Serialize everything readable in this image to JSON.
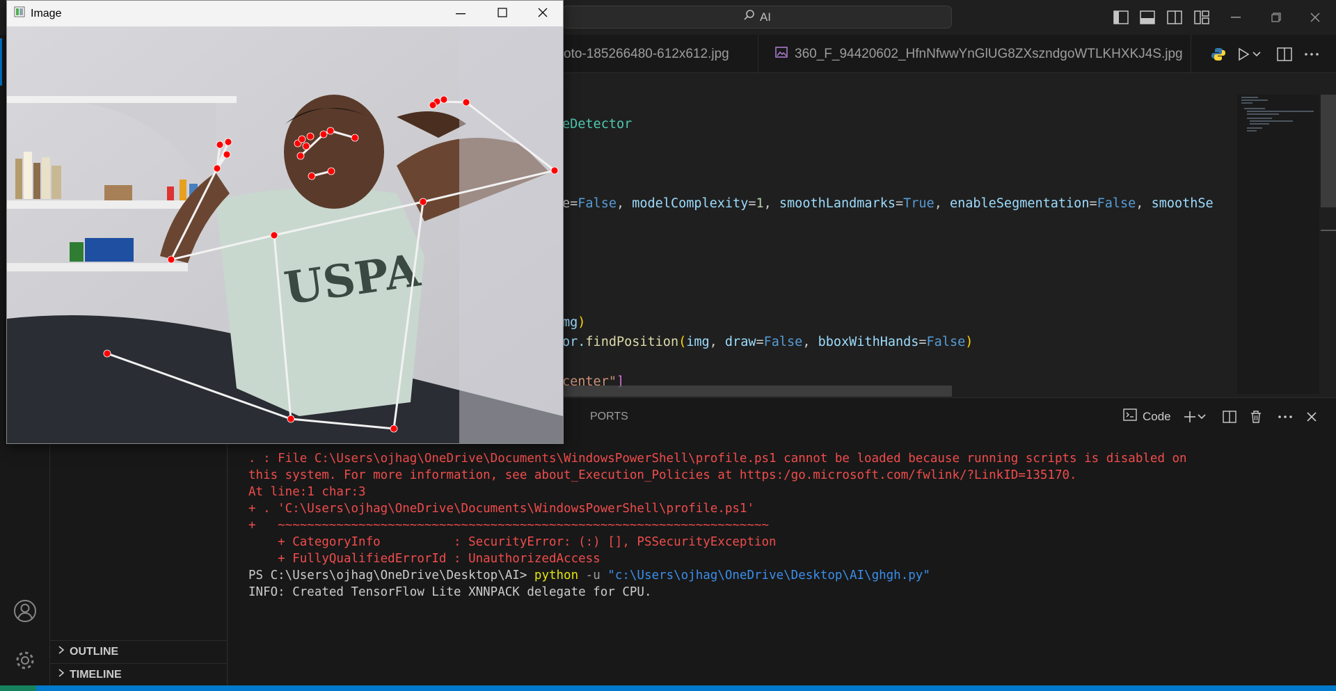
{
  "titlebar": {
    "search_text": "AI"
  },
  "tabs": [
    {
      "label": "oto-185266480-612x612.jpg"
    },
    {
      "label": "360_F_94420602_HfnNfwwYnGlUG8ZXszndgoWTLKHXKJ4S.jpg"
    }
  ],
  "editor": {
    "line1_suffix": "eDetector",
    "line2": {
      "p0": "e=",
      "v0": "False",
      "p1": ", ",
      "a1": "modelComplexity",
      "p2": "=",
      "v1": "1",
      "p3": ", ",
      "a2": "smoothLandmarks",
      "p4": "=",
      "v2": "True",
      "p5": ", ",
      "a3": "enableSegmentation",
      "p6": "=",
      "v3": "False",
      "p7": ", ",
      "a4": "smoothSe"
    },
    "line3": {
      "a": "mg",
      "b": ")"
    },
    "line4": {
      "a": "or.",
      "fn": "findPosition",
      "b": "(",
      "c": "img",
      "d": ", ",
      "e": "draw",
      "f": "=",
      "g": "False",
      "h": ", ",
      "i": "bboxWithHands",
      "j": "=",
      "k": "False",
      "l": ")"
    },
    "line5": {
      "a": "center\"",
      "b": "]"
    }
  },
  "panel": {
    "tab_ports": "PORTS",
    "terminal_name": "Code",
    "lines": [
      {
        "text": ". : File C:\\Users\\ojhag\\OneDrive\\Documents\\WindowsPowerShell\\profile.ps1 cannot be loaded because running scripts is disabled on",
        "kind": "err"
      },
      {
        "text": "this system. For more information, see about_Execution_Policies at https:/go.microsoft.com/fwlink/?LinkID=135170.",
        "kind": "err"
      },
      {
        "text": "At line:1 char:3",
        "kind": "err"
      },
      {
        "text": "+ . 'C:\\Users\\ojhag\\OneDrive\\Documents\\WindowsPowerShell\\profile.ps1'",
        "kind": "err"
      },
      {
        "text": "+   ~~~~~~~~~~~~~~~~~~~~~~~~~~~~~~~~~~~~~~~~~~~~~~~~~~~~~~~~~~~~~~~~~~~",
        "kind": "err"
      },
      {
        "text": "    + CategoryInfo          : SecurityError: (:) [], PSSecurityException",
        "kind": "err"
      },
      {
        "text": "    + FullyQualifiedErrorId : UnauthorizedAccess",
        "kind": "err"
      }
    ],
    "prompt": "PS C:\\Users\\ojhag\\OneDrive\\Desktop\\AI> ",
    "cmd": "python",
    "flag": " -u ",
    "path": "\"c:\\Users\\ojhag\\OneDrive\\Desktop\\AI\\ghgh.py\"",
    "info": "INFO: Created TensorFlow Lite XNNPACK delegate for CPU."
  },
  "sidebar": {
    "outline": "OUTLINE",
    "timeline": "TIMELINE"
  },
  "image_window": {
    "title": "Image"
  },
  "colors": {
    "accent": "#0078d4",
    "status_bar": "#007acc",
    "error_text": "#f14c4c",
    "landmark": "#ff0000"
  }
}
